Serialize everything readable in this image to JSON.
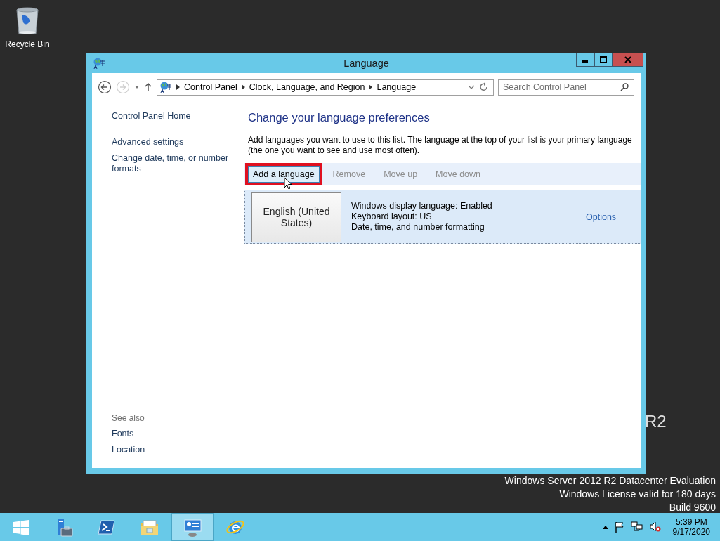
{
  "desktop": {
    "icons": [
      {
        "label": "Recycle Bin"
      }
    ],
    "branding": [
      "R2",
      "Windows Server 2012 R2 Datacenter Evaluation",
      "Windows License valid for 180 days",
      "Build 9600"
    ]
  },
  "window": {
    "title": "Language",
    "nav": [
      {
        "kind": "back",
        "disabled": false
      },
      {
        "kind": "forward",
        "disabled": true
      }
    ],
    "address": [
      "Control Panel",
      "Clock, Language, and Region",
      "Language"
    ],
    "search": {
      "placeholder": "Search Control Panel"
    },
    "sidebar": {
      "links": [
        "Control Panel Home",
        "Advanced settings",
        "Change date, time, or number formats"
      ],
      "see_also": {
        "heading": "See also",
        "links": [
          "Fonts",
          "Location"
        ]
      }
    },
    "main": {
      "heading": "Change your language preferences",
      "description": "Add languages you want to use to this list. The language at the top of your list is your primary language (the one you want to see and use most often).",
      "toolbar": [
        {
          "label": "Add a language",
          "disabled": false,
          "highlighted": true
        },
        {
          "label": "Remove",
          "disabled": true,
          "highlighted": false
        },
        {
          "label": "Move up",
          "disabled": true,
          "highlighted": false
        },
        {
          "label": "Move down",
          "disabled": true,
          "highlighted": false
        }
      ],
      "languages": [
        {
          "name": "English (United States)",
          "details": [
            "Windows display language: Enabled",
            "Keyboard layout: US",
            "Date, time, and number formatting"
          ],
          "options": "Options",
          "selected": true
        }
      ]
    }
  },
  "taskbar": {
    "items": [
      {
        "kind": "start",
        "selected": false
      },
      {
        "kind": "server-manager",
        "selected": false
      },
      {
        "kind": "powershell",
        "selected": false
      },
      {
        "kind": "explorer",
        "selected": false
      },
      {
        "kind": "control-panel",
        "selected": true
      },
      {
        "kind": "ie",
        "selected": false
      }
    ],
    "clock": {
      "time": "5:39 PM",
      "date": "9/17/2020"
    }
  }
}
